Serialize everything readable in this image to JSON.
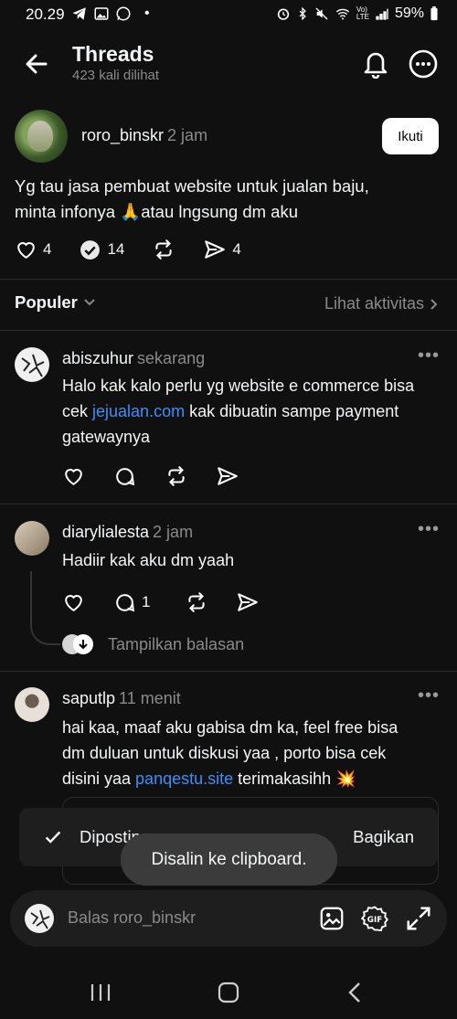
{
  "status_bar": {
    "time": "20.29",
    "battery": "59%"
  },
  "header": {
    "title": "Threads",
    "subtitle": "423 kali dilihat"
  },
  "post": {
    "username": "roro_binskr",
    "time": "2 jam",
    "follow_label": "Ikuti",
    "text_line1": "Yg tau jasa pembuat website untuk jualan baju,",
    "text_line2_a": "minta infonya ",
    "emoji": "🙏",
    "text_line2_b": "atau lngsung dm aku",
    "likes": "4",
    "reposts_count": "14",
    "shares": "4"
  },
  "sort": {
    "label": "Populer",
    "activity_label": "Lihat aktivitas"
  },
  "replies": [
    {
      "username": "abiszuhur",
      "time": "sekarang",
      "line1": "Halo kak kalo perlu yg website e commerce bisa",
      "line2_a": "cek ",
      "link": "jejualan.com",
      "line2_b": " kak dibuatin sampe payment",
      "line3": "gatewaynya"
    },
    {
      "username": "diarylialesta",
      "time": "2 jam",
      "line1": "Hadiir kak aku dm yaah",
      "comments": "1",
      "show_replies": "Tampilkan balasan"
    },
    {
      "username": "saputlp",
      "time": "11 menit",
      "line1": "hai kaa, maaf aku gabisa dm ka, feel free bisa",
      "line2": "dm duluan untuk diskusi yaa , porto bisa cek",
      "line3_a": "disini yaa ",
      "link": "panqestu.site",
      "line3_b": " terimakasihh ",
      "emoji": "💥"
    }
  ],
  "posted_toast": {
    "label": "Diposting",
    "share_label": "Bagikan"
  },
  "clipboard_toast": "Disalin ke clipboard.",
  "composer": {
    "placeholder": "Balas roro_binskr"
  },
  "colors": {
    "background": "#101010",
    "link": "#3d8ef7",
    "muted": "#8a8a8a"
  }
}
